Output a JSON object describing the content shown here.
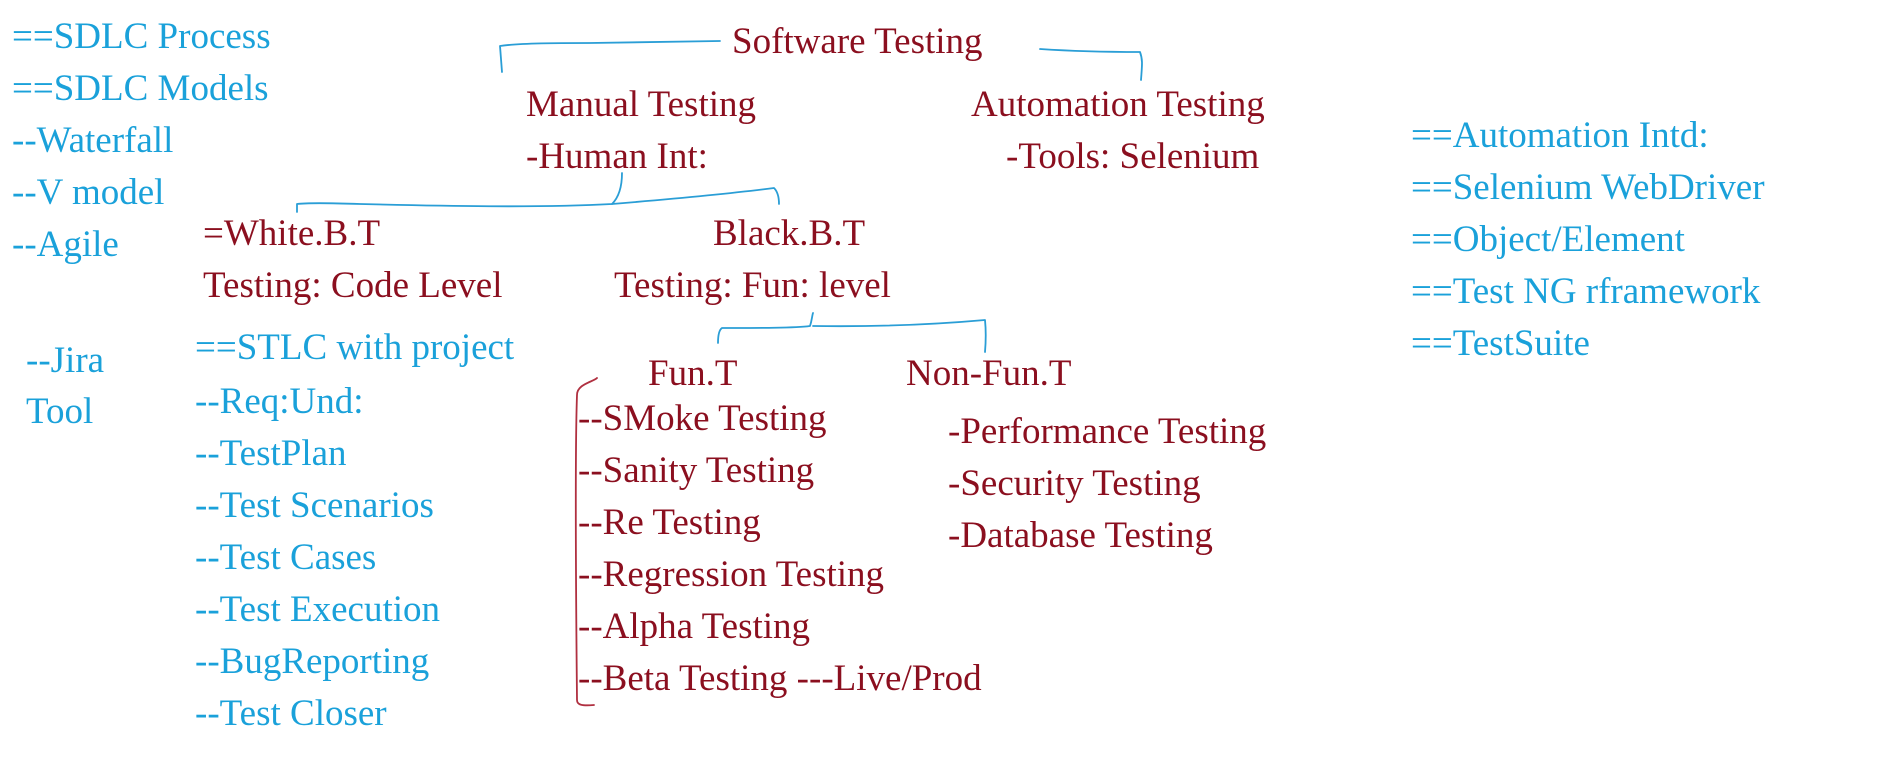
{
  "colors": {
    "blue": "#1aa1da",
    "red": "#8b0f1f"
  },
  "left_notes": {
    "items": [
      "==SDLC Process",
      "==SDLC Models",
      "--Waterfall",
      "--V model",
      "--Agile"
    ],
    "jira": [
      "--Jira",
      "Tool"
    ]
  },
  "stlc": {
    "items": [
      "==STLC with project",
      "--Req:Und:",
      "--TestPlan",
      "--Test Scenarios",
      "--Test Cases",
      "--Test Execution",
      "--BugReporting",
      "--Test Closer"
    ]
  },
  "tree": {
    "root": "Software Testing",
    "manual": {
      "title": "Manual Testing",
      "sub": "-Human Int:"
    },
    "automation": {
      "title": "Automation Testing",
      "sub": "-Tools: Selenium"
    },
    "white_box": {
      "title": "=White.B.T",
      "sub": "Testing: Code Level"
    },
    "black_box": {
      "title": "Black.B.T",
      "sub": "Testing: Fun: level"
    },
    "functional": {
      "title": "Fun.T",
      "items": [
        "--SMoke Testing",
        "--Sanity Testing",
        "--Re Testing",
        "--Regression Testing",
        "--Alpha Testing",
        "--Beta Testing ---Live/Prod"
      ]
    },
    "non_functional": {
      "title": "Non-Fun.T",
      "items": [
        "-Performance Testing",
        "-Security Testing",
        "-Database Testing"
      ]
    }
  },
  "right_notes": {
    "items": [
      "==Automation Intd:",
      "==Selenium WebDriver",
      "==Object/Element",
      "==Test NG rframework",
      "==TestSuite"
    ]
  }
}
